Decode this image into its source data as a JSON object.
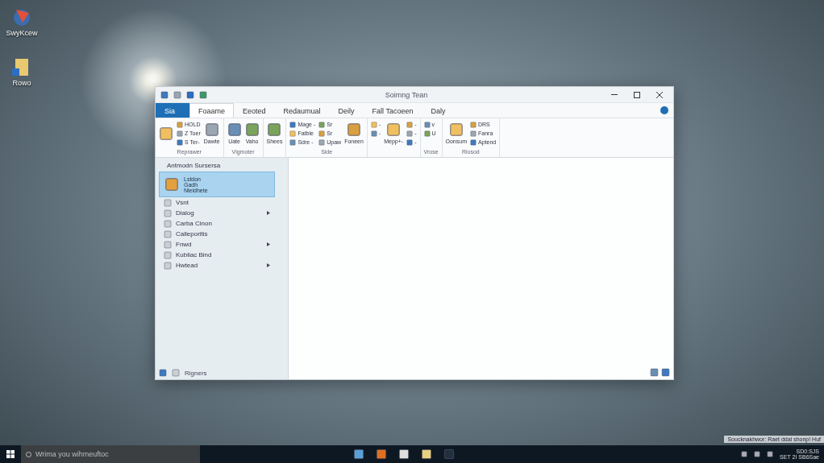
{
  "desktop_icons": [
    {
      "label": "SwyKcew",
      "kind": "app"
    },
    {
      "label": "Rowo",
      "kind": "folder"
    }
  ],
  "window": {
    "title": "Soimng Tean"
  },
  "tabs": [
    {
      "label": "Sia",
      "kind": "file",
      "selected": false
    },
    {
      "label": "Foaame",
      "kind": "ribbon",
      "selected": true
    },
    {
      "label": "Eeoted",
      "kind": "ribbon",
      "selected": false
    },
    {
      "label": "Redaumual",
      "kind": "ribbon",
      "selected": false
    },
    {
      "label": "Deily",
      "kind": "ribbon",
      "selected": false
    },
    {
      "label": "Fall Tacoeen",
      "kind": "ribbon",
      "selected": false
    },
    {
      "label": "Daly",
      "kind": "ribbon",
      "selected": false
    }
  ],
  "ribbon_groups": [
    {
      "label": "Reprawer",
      "items": [
        {
          "kind": "large"
        },
        {
          "kind": "small",
          "label": "HOLD"
        },
        {
          "kind": "small",
          "label": "Z Toer"
        },
        {
          "kind": "small",
          "label": "S Ter-"
        },
        {
          "kind": "large",
          "label": "Dawte"
        }
      ]
    },
    {
      "label": "Vigmoter",
      "items": [
        {
          "kind": "large",
          "label": "Uate"
        },
        {
          "kind": "large",
          "label": "Vaho"
        }
      ]
    },
    {
      "items": [
        {
          "kind": "large",
          "label": "Shees"
        }
      ]
    },
    {
      "label": "Side",
      "items": [
        {
          "kind": "small",
          "label": "Mage -"
        },
        {
          "kind": "small",
          "label": "Fatble"
        },
        {
          "kind": "small",
          "label": "Sdre -"
        },
        {
          "kind": "small",
          "label": "Sr"
        },
        {
          "kind": "small",
          "label": "Sr"
        },
        {
          "kind": "small",
          "label": "Upaw"
        },
        {
          "kind": "large",
          "label": "Foneen"
        }
      ]
    },
    {
      "items": [
        {
          "kind": "small",
          "label": "-"
        },
        {
          "kind": "small",
          "label": "-"
        },
        {
          "kind": "large",
          "label": "Mepp+-"
        },
        {
          "kind": "small",
          "label": "-"
        },
        {
          "kind": "small",
          "label": "-"
        },
        {
          "kind": "small",
          "label": "-"
        }
      ]
    },
    {
      "label": "Vrose",
      "items": [
        {
          "kind": "small",
          "label": "v"
        },
        {
          "kind": "small",
          "label": "U"
        }
      ]
    },
    {
      "label": "Riosod",
      "items": [
        {
          "kind": "large",
          "label": "Oonsum"
        },
        {
          "kind": "small",
          "label": "DRS"
        },
        {
          "kind": "small",
          "label": "Fanra"
        },
        {
          "kind": "small",
          "label": "Aptend"
        }
      ]
    }
  ],
  "nav": {
    "header": "Antmodn Sursersa",
    "card": {
      "lines": [
        "Lstdon",
        "Gadh",
        "Nleidhete"
      ],
      "selected": true
    },
    "items": [
      {
        "label": "Vsnt",
        "has_submenu": false
      },
      {
        "label": "Dialog",
        "has_submenu": true
      },
      {
        "label": "Carba Cinon",
        "has_submenu": false
      },
      {
        "label": "Calleporitis",
        "has_submenu": false
      },
      {
        "label": "Fnwd",
        "has_submenu": true
      },
      {
        "label": "Kubliac Bind",
        "has_submenu": false
      },
      {
        "label": "Hwtead",
        "has_submenu": true
      }
    ],
    "status": "Rigners"
  },
  "taskbar": {
    "search_placeholder": "Wrima you wihmeuftoc",
    "notification": "Soucknakhwor: Raet ddal shonp! Huf",
    "time": "SD0:SJS",
    "date": "SET 2I SB6Sae"
  }
}
